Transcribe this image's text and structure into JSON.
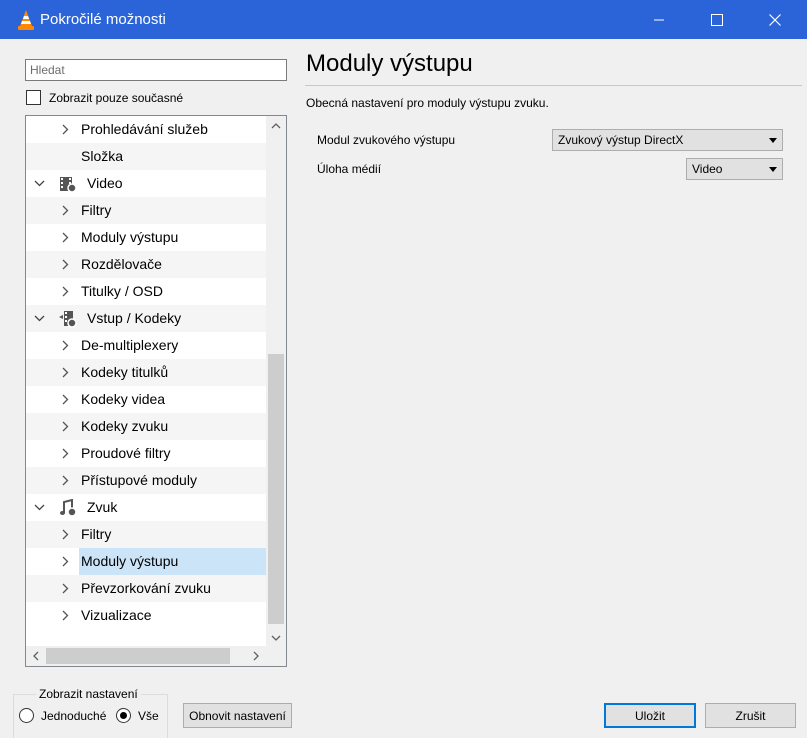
{
  "window": {
    "title": "Pokročilé možnosti",
    "app_icon": "vlc-cone-icon",
    "title_bar_color": "#2a64d8",
    "controls": [
      "minimize-icon",
      "maximize-icon",
      "close-icon"
    ]
  },
  "search": {
    "placeholder": "Hledat",
    "value": ""
  },
  "show_current_only": {
    "label": "Zobrazit pouze současné",
    "checked": false
  },
  "tree": {
    "selected_color": "#cce4f7",
    "items": [
      {
        "label": "Prohledávání služeb",
        "level": 2,
        "chevron": "right"
      },
      {
        "label": "Složka",
        "level": 2,
        "chevron": "none"
      },
      {
        "label": "Video",
        "level": 1,
        "chevron": "down",
        "icon": "video-settings-icon"
      },
      {
        "label": "Filtry",
        "level": 2,
        "chevron": "right"
      },
      {
        "label": "Moduly výstupu",
        "level": 2,
        "chevron": "right"
      },
      {
        "label": "Rozdělovače",
        "level": 2,
        "chevron": "right"
      },
      {
        "label": "Titulky / OSD",
        "level": 2,
        "chevron": "right"
      },
      {
        "label": "Vstup / Kodeky",
        "level": 1,
        "chevron": "down",
        "icon": "input-codecs-icon"
      },
      {
        "label": "De-multiplexery",
        "level": 2,
        "chevron": "right"
      },
      {
        "label": "Kodeky titulků",
        "level": 2,
        "chevron": "right"
      },
      {
        "label": "Kodeky videa",
        "level": 2,
        "chevron": "right"
      },
      {
        "label": "Kodeky zvuku",
        "level": 2,
        "chevron": "right"
      },
      {
        "label": "Proudové filtry",
        "level": 2,
        "chevron": "right"
      },
      {
        "label": "Přístupové moduly",
        "level": 2,
        "chevron": "right"
      },
      {
        "label": "Zvuk",
        "level": 1,
        "chevron": "down",
        "icon": "audio-settings-icon"
      },
      {
        "label": "Filtry",
        "level": 2,
        "chevron": "right"
      },
      {
        "label": "Moduly výstupu",
        "level": 2,
        "chevron": "right",
        "selected": true
      },
      {
        "label": "Převzorkování zvuku",
        "level": 2,
        "chevron": "right"
      },
      {
        "label": "Vizualizace",
        "level": 2,
        "chevron": "right"
      }
    ]
  },
  "panel": {
    "title": "Moduly výstupu",
    "description": "Obecná nastavení pro moduly výstupu zvuku.",
    "fields": [
      {
        "label": "Modul zvukového výstupu",
        "value": "Zvukový výstup DirectX"
      },
      {
        "label": "Úloha médií",
        "value": "Video"
      }
    ]
  },
  "display_settings": {
    "title": "Zobrazit nastavení",
    "options": [
      {
        "label": "Jednoduché",
        "checked": false
      },
      {
        "label": "Vše",
        "checked": true
      }
    ]
  },
  "buttons": {
    "reset": "Obnovit nastavení",
    "save": "Uložit",
    "cancel": "Zrušit",
    "save_border_color": "#0078d7"
  }
}
